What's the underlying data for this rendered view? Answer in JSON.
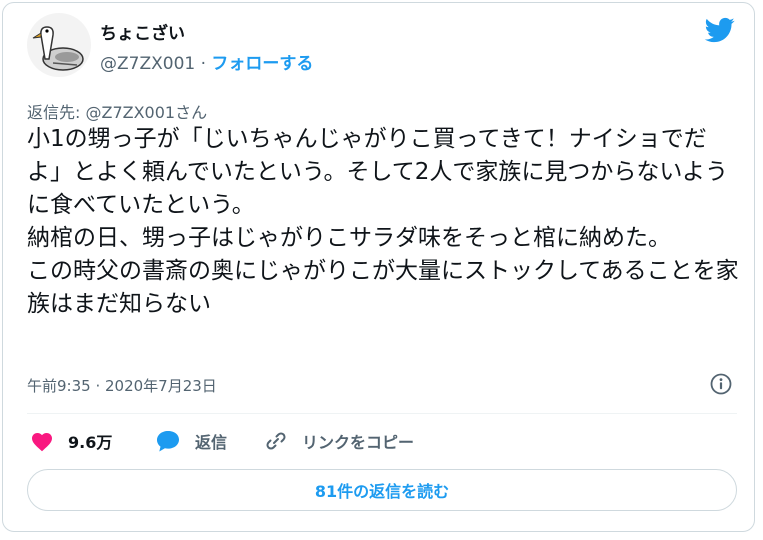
{
  "author": {
    "display_name": "ちょこざい",
    "handle": "@Z7ZX001",
    "separator": "·",
    "follow_label": "フォローする"
  },
  "reply_to": "返信先: @Z7ZX001さん",
  "tweet": {
    "text": "小1の甥っ子が「じいちゃんじゃがりこ買ってきて！ナイショでだよ」とよく頼んでいたという。そして2人で家族に見つからないように食べていたという。\n納棺の日、甥っ子はじゃがりこサラダ味をそっと棺に納めた。\nこの時父の書斎の奥にじゃがりこが大量にストックしてあることを家族はまだ知らない",
    "timestamp": "午前9:35 · 2020年7月23日"
  },
  "actions": {
    "like_count": "9.6万",
    "reply_label": "返信",
    "copy_link_label": "リンクをコピー"
  },
  "read_replies_label": "81件の返信を読む",
  "icons": {
    "brand": "twitter-bird-icon",
    "like": "heart-icon",
    "reply": "speech-bubble-icon",
    "link": "link-icon",
    "info": "info-icon"
  },
  "colors": {
    "accent": "#1d9bf0",
    "like": "#f91880",
    "secondary_text": "#536471",
    "border": "#cfd9de"
  }
}
